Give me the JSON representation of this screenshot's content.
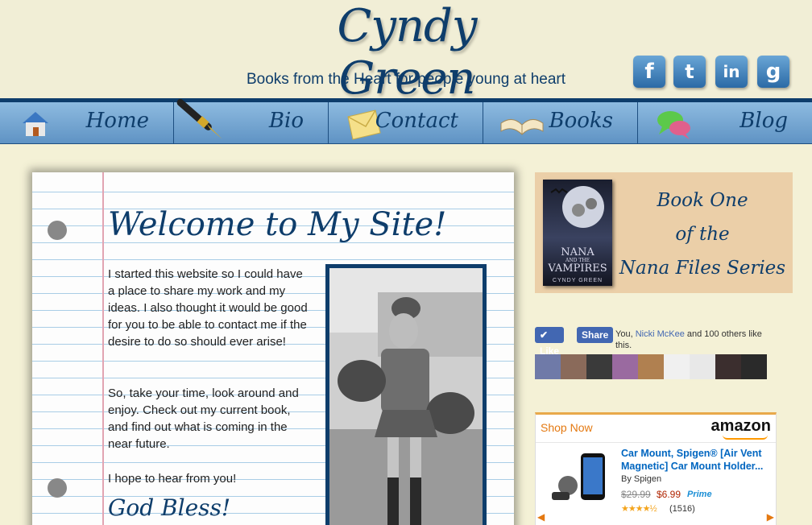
{
  "header": {
    "title": "Cyndy Green",
    "tagline": "Books from the Heart for people young at heart",
    "social": [
      {
        "name": "facebook-icon",
        "glyph": "f",
        "colors": [
          "#6aa6d6",
          "#2b6aa6"
        ]
      },
      {
        "name": "twitter-icon",
        "glyph": "t",
        "colors": [
          "#6aa6d6",
          "#2b6aa6"
        ]
      },
      {
        "name": "linkedin-icon",
        "glyph": "in",
        "colors": [
          "#6aa6d6",
          "#2b6aa6"
        ]
      },
      {
        "name": "google-icon",
        "glyph": "g",
        "colors": [
          "#6aa6d6",
          "#2b6aa6"
        ]
      }
    ]
  },
  "nav": {
    "items": [
      {
        "label": "Home",
        "icon": "house-icon"
      },
      {
        "label": "Bio",
        "icon": "fountain-pen-icon"
      },
      {
        "label": "Contact",
        "icon": "envelope-icon"
      },
      {
        "label": "Books",
        "icon": "open-book-icon"
      },
      {
        "label": "Blog",
        "icon": "speech-bubbles-icon"
      }
    ]
  },
  "main": {
    "heading": "Welcome to My Site!",
    "paragraph1": "I started this website so I could have a place to share my work and my ideas. I also thought it would be good for you to be able to contact me if the desire to do so should ever arise!",
    "paragraph2": "So, take your time, look around and enjoy. Check out my current book, and find out what is coming in the near future.",
    "paragraph3": "I hope to hear from you!",
    "signoff": "God Bless!",
    "photo": "cheerleader-photo"
  },
  "sidebar": {
    "promo": {
      "cover_title_1": "NANA",
      "cover_title_2": "AND THE",
      "cover_title_3": "VAMPIRES",
      "cover_author": "CYNDY GREEN",
      "line1": "Book One",
      "line2": "of the",
      "line3": "Nana Files Series"
    },
    "facebook": {
      "like_label": "Like",
      "share_label": "Share",
      "text_prefix": "You, ",
      "friend_name": "Nicki McKee",
      "text_suffix": " and 100 others like this.",
      "friend_color": "#4267b2"
    },
    "amazon": {
      "shop_now": "Shop Now",
      "logo": "amazon",
      "product_title": "Car Mount, Spigen® [Air Vent Magnetic] Car Mount Holder...",
      "brand": "By Spigen",
      "old_price": "$29.99",
      "new_price": "$6.99",
      "prime": "Prime",
      "stars": "★★★★½",
      "reviews": "(1516)"
    }
  },
  "colors": {
    "brand_navy": "#0e3d6b",
    "nav_blue": "#6b9fcf",
    "page_bg": "#f4f1d6",
    "promo_bg": "#ebcfa8",
    "amazon_orange": "#e47911"
  }
}
